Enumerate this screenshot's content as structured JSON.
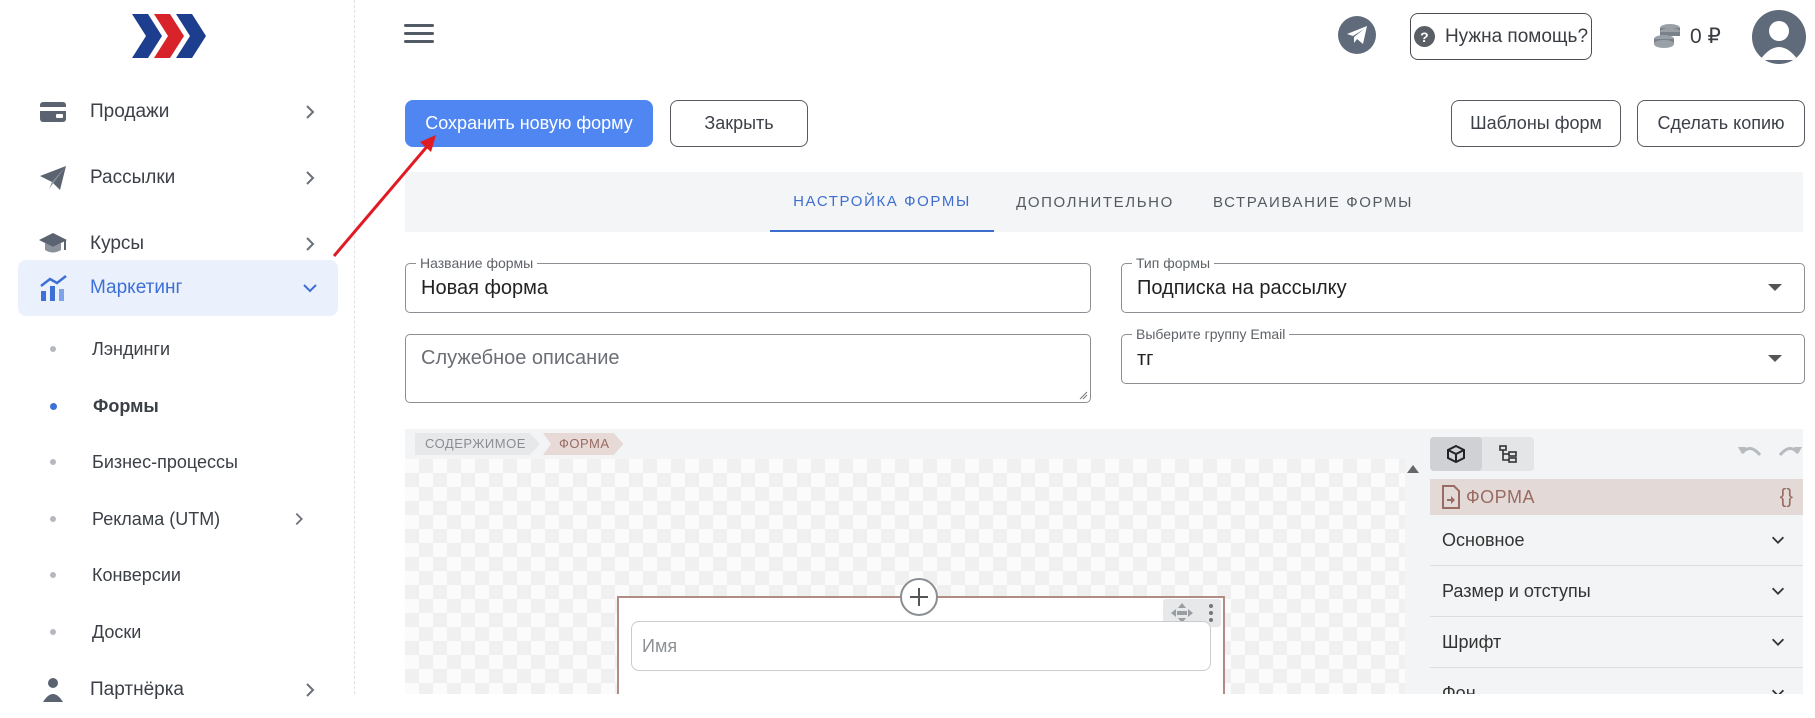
{
  "sidebar": {
    "items": [
      {
        "label": "Продажи",
        "icon": "wallet-icon"
      },
      {
        "label": "Рассылки",
        "icon": "paper-plane-icon"
      },
      {
        "label": "Курсы",
        "icon": "graduation-cap-icon"
      },
      {
        "label": "Маркетинг",
        "icon": "chart-icon"
      }
    ],
    "sub_items": [
      {
        "label": "Лэндинги"
      },
      {
        "label": "Формы"
      },
      {
        "label": "Бизнес-процессы"
      },
      {
        "label": "Реклама (UTM)"
      },
      {
        "label": "Конверсии"
      },
      {
        "label": "Доски"
      }
    ],
    "partner": {
      "label": "Партнёрка",
      "icon": "users-icon"
    },
    "accent_color": "#3d6fd6"
  },
  "header": {
    "help_label": "Нужна помощь?",
    "balance": "0 ₽"
  },
  "toolbar": {
    "save_label": "Сохранить новую форму",
    "close_label": "Закрыть",
    "templates_label": "Шаблоны форм",
    "copy_label": "Сделать копию"
  },
  "tabs": [
    {
      "label": "НАСТРОЙКА ФОРМЫ",
      "active": true
    },
    {
      "label": "ДОПОЛНИТЕЛЬНО",
      "active": false
    },
    {
      "label": "ВСТРАИВАНИЕ ФОРМЫ",
      "active": false
    }
  ],
  "form": {
    "name_label": "Название формы",
    "name_value": "Новая форма",
    "type_label": "Тип формы",
    "type_value": "Подписка на рассылку",
    "description_placeholder": "Служебное описание",
    "group_label": "Выберите группу Email",
    "group_value": "тг"
  },
  "editor": {
    "breadcrumb": [
      "СОДЕРЖИМОЕ",
      "ФОРМА"
    ],
    "name_placeholder": "Имя",
    "component_name": "ФОРМА",
    "code_symbol": "{}",
    "sections": [
      "Основное",
      "Размер и отступы",
      "Шрифт",
      "Фон"
    ]
  }
}
